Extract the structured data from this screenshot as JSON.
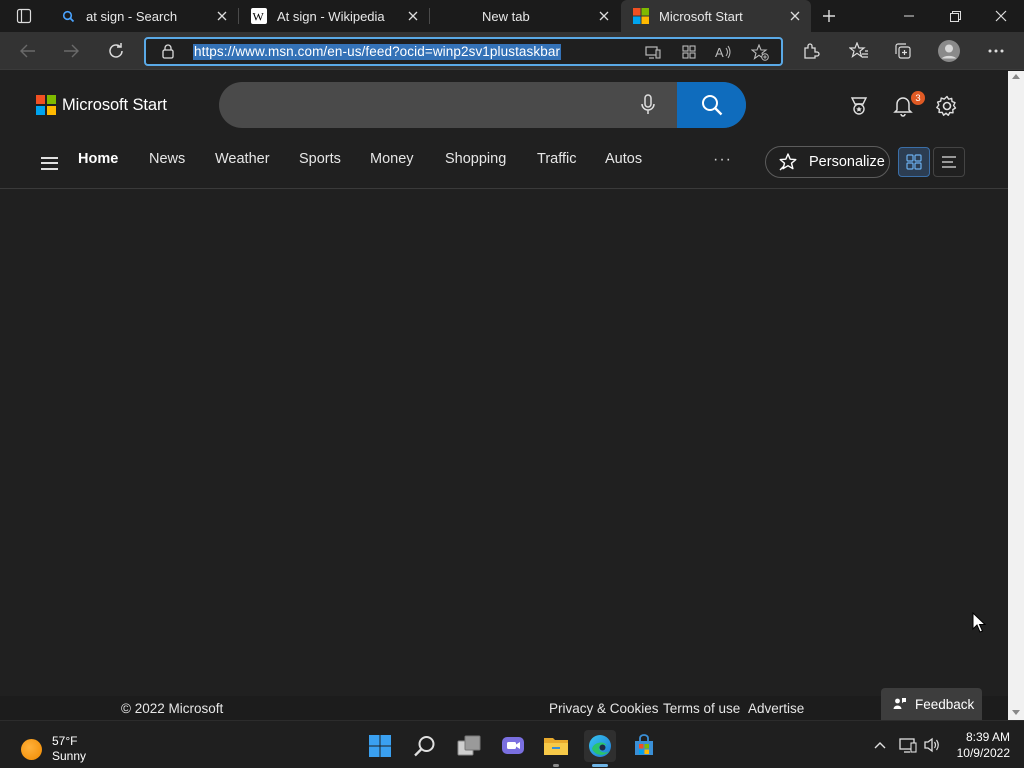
{
  "browser": {
    "tabs": [
      {
        "title": "at sign - Search",
        "favicon": "search-icon"
      },
      {
        "title": "At sign - Wikipedia",
        "favicon": "wikipedia-icon"
      },
      {
        "title": "New tab",
        "favicon": ""
      },
      {
        "title": "Microsoft Start",
        "favicon": "microsoft-logo-icon",
        "active": true
      }
    ],
    "address": {
      "url": "https://www.msn.com/en-us/feed?ocid=winp2sv1plustaskbar"
    }
  },
  "site": {
    "brand": "Microsoft Start",
    "search": {
      "placeholder": ""
    },
    "notification_count": "3",
    "nav": {
      "items": [
        "Home",
        "News",
        "Weather",
        "Sports",
        "Money",
        "Shopping",
        "Traffic",
        "Autos"
      ],
      "more": "···",
      "personalize": "Personalize"
    },
    "footer": {
      "copyright": "© 2022 Microsoft",
      "links": [
        "Privacy & Cookies",
        "Terms of use",
        "Advertise"
      ],
      "feedback": "Feedback"
    }
  },
  "taskbar": {
    "weather": {
      "temp": "57°F",
      "condition": "Sunny"
    },
    "clock": {
      "time": "8:39 AM",
      "date": "10/9/2022"
    },
    "apps": [
      "start-icon",
      "search-icon",
      "task-view-icon",
      "chat-icon",
      "file-explorer-icon",
      "edge-icon",
      "store-icon"
    ]
  },
  "colors": {
    "accent": "#0f6cbd",
    "omnibox_focus": "#5aa9e6",
    "url_selection": "#3472b7",
    "page_bg": "#202020",
    "badge": "#e05a24"
  }
}
